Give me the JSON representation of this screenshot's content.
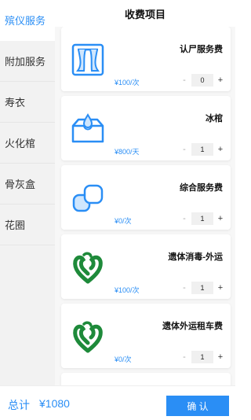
{
  "header": {
    "title": "收费项目"
  },
  "sidebar": {
    "items": [
      {
        "label": "殡仪服务",
        "active": true
      },
      {
        "label": "附加服务"
      },
      {
        "label": "寿衣"
      },
      {
        "label": "火化棺"
      },
      {
        "label": "骨灰盒"
      },
      {
        "label": "花圈"
      }
    ]
  },
  "items": [
    {
      "name": "认尸服务费",
      "price": "¥100/次",
      "qty": "0",
      "icon": "window-curtain-icon",
      "minus": "-",
      "plus": "+"
    },
    {
      "name": "冰棺",
      "price": "¥800/天",
      "qty": "1",
      "icon": "ice-coffin-icon",
      "minus": "-",
      "plus": "+"
    },
    {
      "name": "综合服务费",
      "price": "¥0/次",
      "qty": "1",
      "icon": "service-blocks-icon",
      "minus": "-",
      "plus": "+"
    },
    {
      "name": "遗体消毒-外运",
      "price": "¥100/次",
      "qty": "1",
      "icon": "green-heart-logo-icon",
      "minus": "-",
      "plus": "+"
    },
    {
      "name": "遗体外运租车费",
      "price": "¥0/次",
      "qty": "1",
      "icon": "green-heart-logo-icon",
      "minus": "-",
      "plus": "+"
    }
  ],
  "footer": {
    "total_label": "总计",
    "total_value": "¥1080",
    "confirm_label": "确 认"
  },
  "colors": {
    "accent": "#2a8ef5",
    "logo_green": "#1e8a3a"
  }
}
